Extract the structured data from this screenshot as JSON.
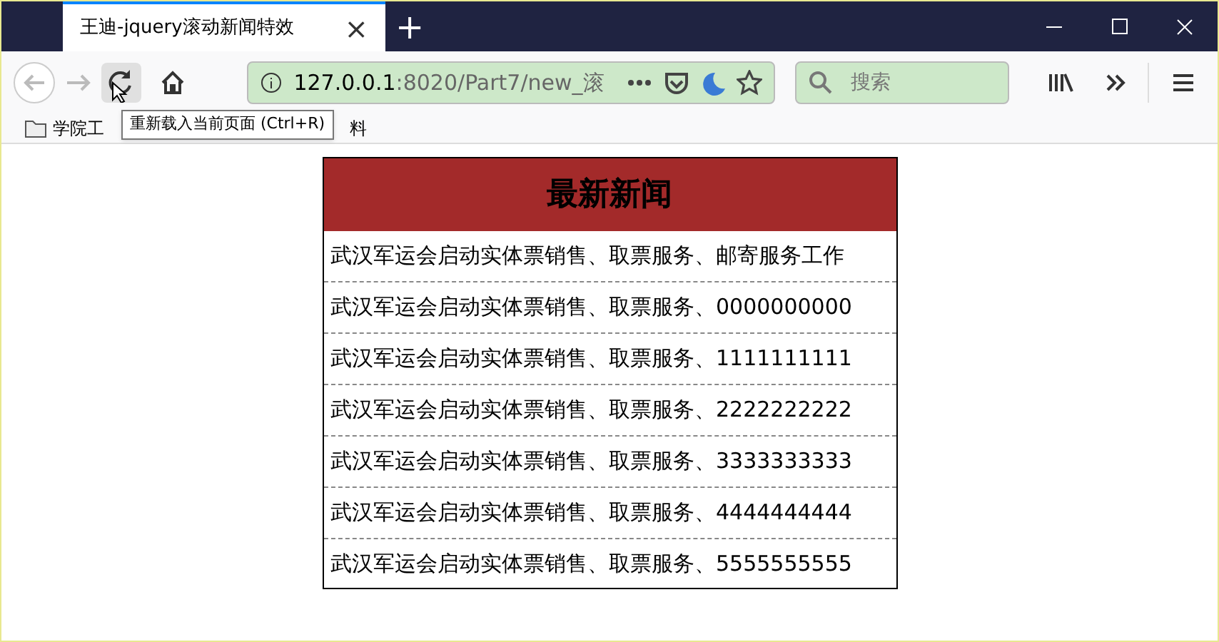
{
  "tab": {
    "title": "王迪-jquery滚动新闻特效",
    "close": "×",
    "new_tab": "+"
  },
  "address_bar": {
    "host": "127.0.0.1",
    "path": ":8020/Part7/new_滚"
  },
  "search": {
    "placeholder": "搜索"
  },
  "bookmarks": [
    {
      "label": "学院工"
    },
    {
      "label": "料"
    }
  ],
  "tooltip": "重新载入当前页面 (Ctrl+R)",
  "news": {
    "title": "最新新闻",
    "items": [
      "武汉军运会启动实体票销售、取票服务、邮寄服务工作",
      "武汉军运会启动实体票销售、取票服务、0000000000",
      "武汉军运会启动实体票销售、取票服务、1111111111",
      "武汉军运会启动实体票销售、取票服务、2222222222",
      "武汉军运会启动实体票销售、取票服务、3333333333",
      "武汉军运会启动实体票销售、取票服务、4444444444",
      "武汉军运会启动实体票销售、取票服务、5555555555"
    ]
  }
}
